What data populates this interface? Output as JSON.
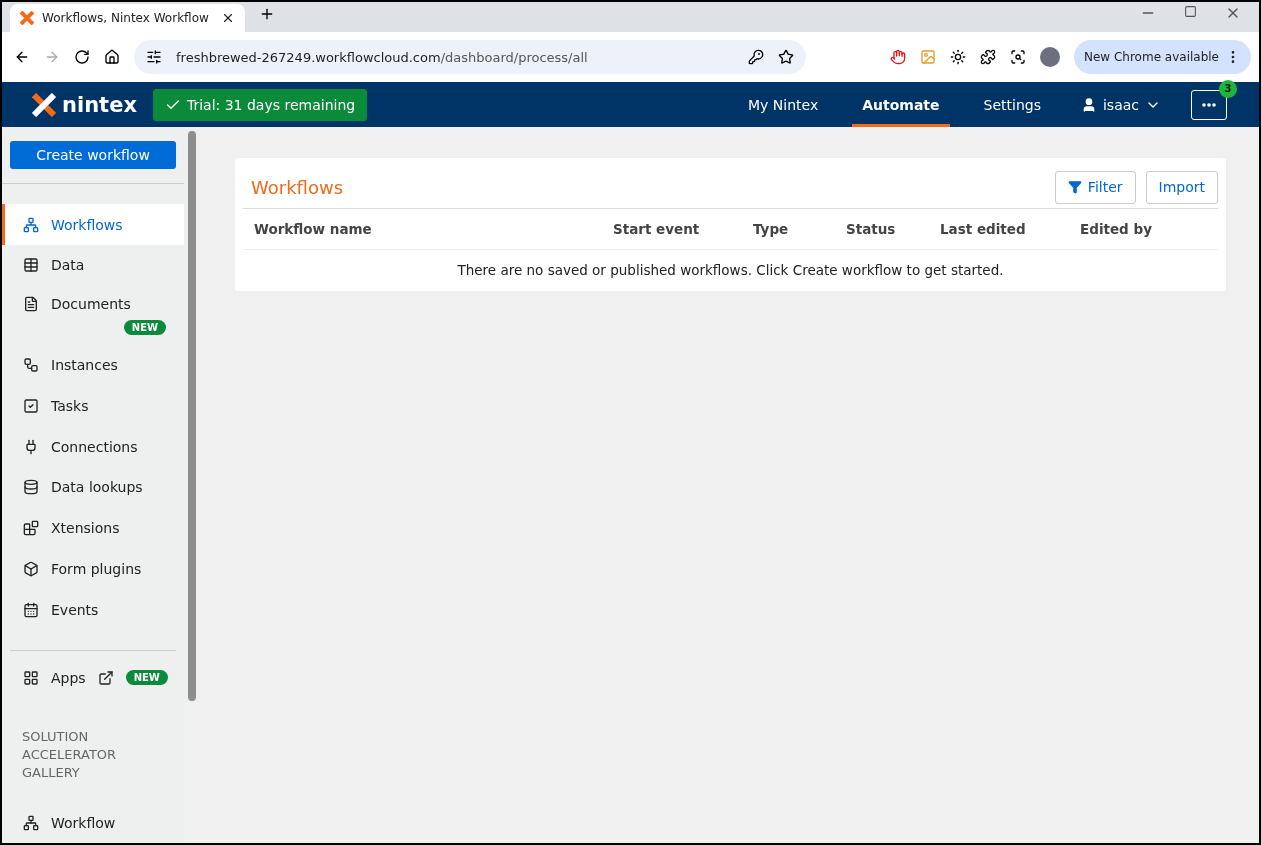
{
  "browser": {
    "tab_title": "Workflows, Nintex Workflow",
    "url_host": "freshbrewed-267249.workflowcloud.com",
    "url_path": "/dashboard/process/all",
    "update_button": "New Chrome available"
  },
  "header": {
    "logo": "nintex",
    "trial": "Trial: 31 days remaining",
    "nav": [
      {
        "label": "My Nintex",
        "selected": false
      },
      {
        "label": "Automate",
        "selected": true
      },
      {
        "label": "Settings",
        "selected": false
      }
    ],
    "user": "isaac",
    "more_badge": "3"
  },
  "sidebar": {
    "create_button": "Create workflow",
    "items": [
      {
        "label": "Workflows",
        "selected": true
      },
      {
        "label": "Data",
        "selected": false
      },
      {
        "label": "Documents",
        "selected": false,
        "badge": "NEW"
      },
      {
        "label": "Instances",
        "selected": false
      },
      {
        "label": "Tasks",
        "selected": false
      },
      {
        "label": "Connections",
        "selected": false
      },
      {
        "label": "Data lookups",
        "selected": false
      },
      {
        "label": "Xtensions",
        "selected": false
      },
      {
        "label": "Form plugins",
        "selected": false
      },
      {
        "label": "Events",
        "selected": false
      }
    ],
    "apps": {
      "label": "Apps",
      "badge": "NEW"
    },
    "section_title": "SOLUTION ACCELERATOR GALLERY",
    "gallery_items": [
      {
        "label": "Workflow",
        "selected": false
      }
    ]
  },
  "panel": {
    "title": "Workflows",
    "buttons": [
      "Filter",
      "Import"
    ],
    "columns": [
      "Workflow name",
      "Start event",
      "Type",
      "Status",
      "Last edited",
      "Edited by"
    ],
    "empty_message": "There are no saved or published workflows. Click Create workflow to get started."
  }
}
